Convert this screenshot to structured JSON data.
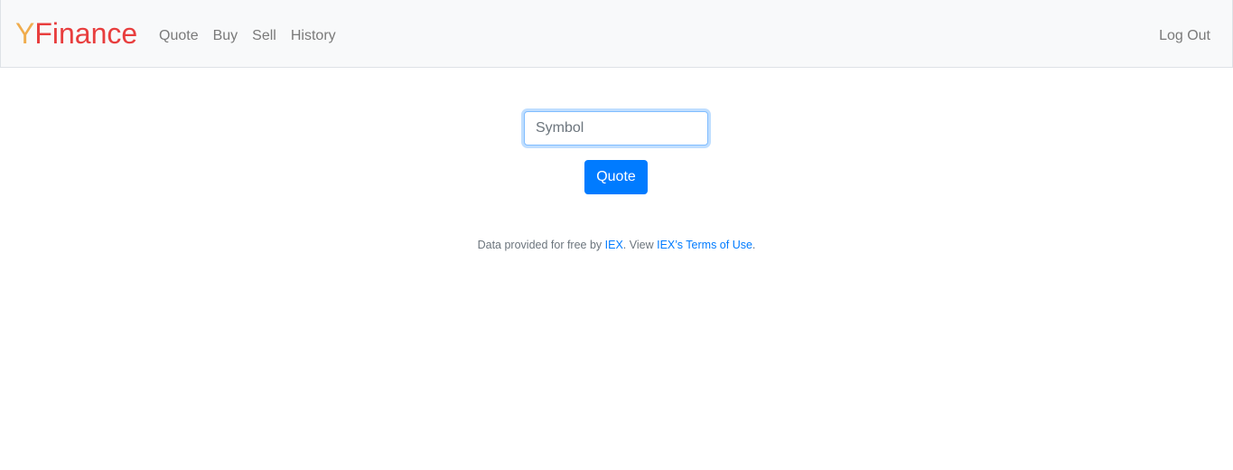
{
  "brand": {
    "first": "Y",
    "rest": "Finance"
  },
  "nav": {
    "items": [
      {
        "label": "Quote"
      },
      {
        "label": "Buy"
      },
      {
        "label": "Sell"
      },
      {
        "label": "History"
      }
    ]
  },
  "logout_label": "Log Out",
  "form": {
    "symbol_placeholder": "Symbol",
    "submit_label": "Quote"
  },
  "footer": {
    "text_before": "Data provided for free by ",
    "iex_link": "IEX",
    "text_middle": ". View ",
    "terms_link": "IEX’s Terms of Use",
    "text_after": "."
  },
  "colors": {
    "brand_y": "#f0ad4e",
    "brand_finance": "#e83e3e",
    "primary": "#007bff",
    "navbar_bg": "#f8f9fa"
  }
}
